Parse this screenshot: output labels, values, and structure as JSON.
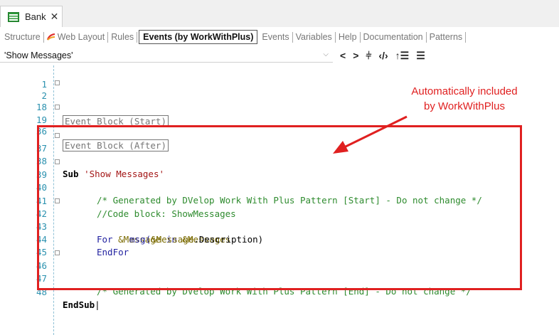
{
  "tab": {
    "title": "Bank",
    "close": "✕"
  },
  "subtabs": [
    "Structure",
    "Web Layout",
    "Rules",
    "Events (by WorkWithPlus)",
    "Events",
    "Variables",
    "Help",
    "Documentation",
    "Patterns"
  ],
  "event_selector": {
    "value": "'Show Messages'",
    "chevron": "⌵"
  },
  "toolbar": [
    "<",
    ">",
    "⫩",
    "‹/›",
    "↑☰",
    "☰"
  ],
  "editor_lines": [
    {
      "num": "1"
    },
    {
      "num": "2",
      "text": "Event Block (Start)"
    },
    {
      "num": "18"
    },
    {
      "num": "19",
      "text": "Event Block (After)"
    },
    {
      "num": "36"
    },
    {
      "num": "37",
      "kw": "Sub",
      "str": "'Show Messages'"
    },
    {
      "num": "38"
    },
    {
      "num": "39",
      "comment": "/* Generated by DVelop Work With Plus Pattern [Start] - Do not change */"
    },
    {
      "num": "40"
    },
    {
      "num": "41",
      "comment": "//Code block: ShowMessages"
    },
    {
      "num": "42",
      "kw1": "For",
      "var1": "&Message",
      "kw2": "in",
      "var2": "&Messages"
    },
    {
      "num": "43",
      "fn": "msg(",
      "var": "&Message",
      "rest": ".Description)"
    },
    {
      "num": "44",
      "kw": "EndFor"
    },
    {
      "num": "45"
    },
    {
      "num": "46",
      "comment": "/* Generated by DVelop Work With Plus Pattern [End] - Do not change */"
    },
    {
      "num": "47"
    },
    {
      "num": "48",
      "kw": "EndSub"
    }
  ],
  "annotation": {
    "line1": "Automatically included",
    "line2": "by WorkWithPlus"
  },
  "colors": {
    "annotation": "#e02020",
    "line_numbers": "#2b91af",
    "comment": "#2e8b2e",
    "string": "#a31515"
  }
}
